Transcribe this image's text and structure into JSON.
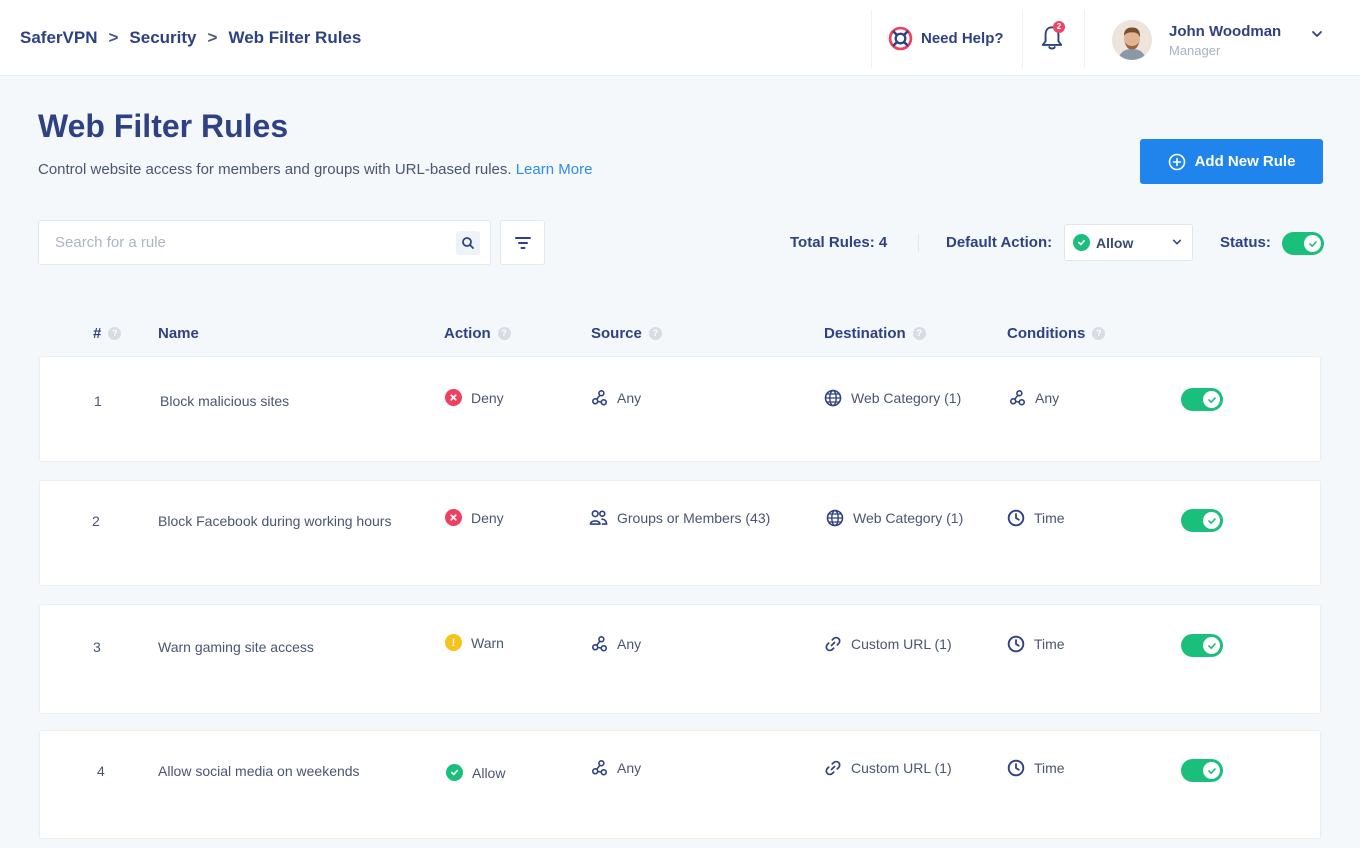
{
  "breadcrumb": [
    "SaferVPN",
    "Security",
    "Web Filter Rules"
  ],
  "header": {
    "help_label": "Need Help?",
    "notification_count": "2",
    "user_name": "John Woodman",
    "user_role": "Manager"
  },
  "page": {
    "title": "Web Filter Rules",
    "subtitle": "Control website access for members and groups with URL-based rules.",
    "learn_more": "Learn More",
    "add_button": "Add New Rule"
  },
  "toolbar": {
    "search_placeholder": "Search for a rule",
    "total_rules": "Total Rules: 4",
    "default_action_label": "Default Action:",
    "default_action_value": "Allow",
    "status_label": "Status:",
    "status_on": true
  },
  "table": {
    "headers": {
      "num": "#",
      "name": "Name",
      "action": "Action",
      "source": "Source",
      "destination": "Destination",
      "conditions": "Conditions"
    },
    "rows": [
      {
        "num": "1",
        "name": "Block malicious sites",
        "action": "Deny",
        "action_type": "deny",
        "source": "Any",
        "source_icon": "share-nodes-icon",
        "destination": "Web Category (1)",
        "destination_icon": "globe-icon",
        "condition": "Any",
        "condition_icon": "share-nodes-icon",
        "enabled": true
      },
      {
        "num": "2",
        "name": "Block Facebook during working hours",
        "action": "Deny",
        "action_type": "deny",
        "source": "Groups or Members (43)",
        "source_icon": "users-icon",
        "destination": "Web Category (1)",
        "destination_icon": "globe-icon",
        "condition": "Time",
        "condition_icon": "clock-icon",
        "enabled": true
      },
      {
        "num": "3",
        "name": "Warn gaming site access",
        "action": "Warn",
        "action_type": "warn",
        "source": "Any",
        "source_icon": "share-nodes-icon",
        "destination": "Custom URL (1)",
        "destination_icon": "link-icon",
        "condition": "Time",
        "condition_icon": "clock-icon",
        "enabled": true
      },
      {
        "num": "4",
        "name": "Allow social media on weekends",
        "action": "Allow",
        "action_type": "allow",
        "source": "Any",
        "source_icon": "share-nodes-icon",
        "destination": "Custom URL (1)",
        "destination_icon": "link-icon",
        "condition": "Time",
        "condition_icon": "clock-icon",
        "enabled": true
      }
    ]
  },
  "colors": {
    "primary": "#1f85ec",
    "navy": "#2e4283",
    "deny": "#f0405f",
    "warn": "#f6c21c",
    "allow": "#1bbf7c"
  }
}
